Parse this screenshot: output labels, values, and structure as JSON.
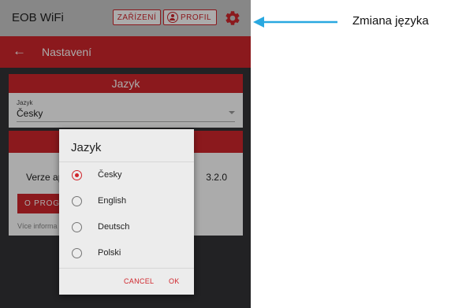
{
  "topbar": {
    "app_name": "EOB WiFi",
    "devices_label": "ZAŘÍZENÍ",
    "profile_label": "PROFIL"
  },
  "navbar": {
    "title": "Nastavení"
  },
  "language_card": {
    "header": "Jazyk",
    "field_label": "Jazyk",
    "field_value": "Česky"
  },
  "about_card": {
    "version_label": "Verze ap",
    "version_value": "3.2.0",
    "about_button": "O PROG",
    "more_info": "Více informa"
  },
  "dialog": {
    "title": "Jazyk",
    "options": [
      {
        "label": "Česky",
        "checked": true
      },
      {
        "label": "English",
        "checked": false
      },
      {
        "label": "Deutsch",
        "checked": false
      },
      {
        "label": "Polski",
        "checked": false
      }
    ],
    "cancel_label": "CANCEL",
    "ok_label": "OK"
  },
  "annotation": {
    "text": "Zmiana języka"
  },
  "colors": {
    "accent": "#d0262c",
    "topbar_bg": "#c9c9c9",
    "annotation_arrow": "#29a8e0"
  },
  "icons": {
    "back": "arrow-left-icon",
    "profile": "user-circle-icon",
    "settings": "gear-icon"
  }
}
